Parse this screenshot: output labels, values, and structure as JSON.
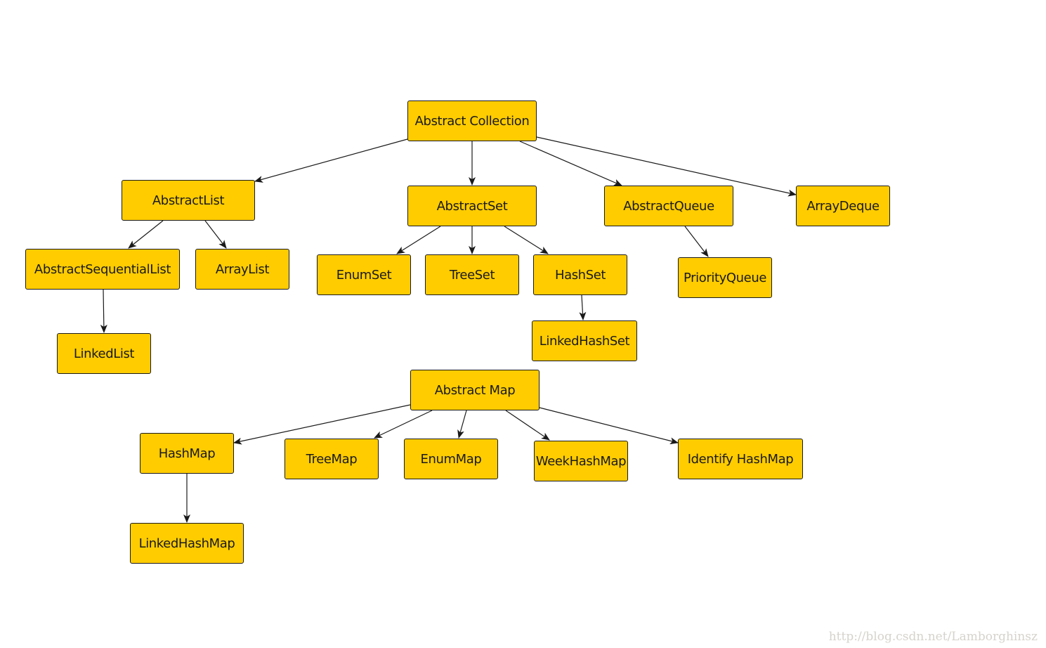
{
  "diagram": {
    "node_color": "#ffcc00",
    "nodes": [
      {
        "id": "abstract-collection",
        "label": "Abstract Collection"
      },
      {
        "id": "abstract-list",
        "label": "AbstractList"
      },
      {
        "id": "abstract-set",
        "label": "AbstractSet"
      },
      {
        "id": "abstract-queue",
        "label": "AbstractQueue"
      },
      {
        "id": "array-deque",
        "label": "ArrayDeque"
      },
      {
        "id": "abstract-sequential-list",
        "label": "AbstractSequentialList"
      },
      {
        "id": "array-list",
        "label": "ArrayList"
      },
      {
        "id": "enum-set",
        "label": "EnumSet"
      },
      {
        "id": "tree-set",
        "label": "TreeSet"
      },
      {
        "id": "hash-set",
        "label": "HashSet"
      },
      {
        "id": "priority-queue",
        "label": "PriorityQueue"
      },
      {
        "id": "linked-list",
        "label": "LinkedList"
      },
      {
        "id": "linked-hash-set",
        "label": "LinkedHashSet"
      },
      {
        "id": "abstract-map",
        "label": "Abstract Map"
      },
      {
        "id": "hash-map",
        "label": "HashMap"
      },
      {
        "id": "tree-map",
        "label": "TreeMap"
      },
      {
        "id": "enum-map",
        "label": "EnumMap"
      },
      {
        "id": "week-hash-map",
        "label": "WeekHashMap"
      },
      {
        "id": "identify-hash-map",
        "label": "Identify HashMap"
      },
      {
        "id": "linked-hash-map",
        "label": "LinkedHashMap"
      }
    ],
    "edges": [
      {
        "from": "abstract-collection",
        "to": "abstract-list"
      },
      {
        "from": "abstract-collection",
        "to": "abstract-set"
      },
      {
        "from": "abstract-collection",
        "to": "abstract-queue"
      },
      {
        "from": "abstract-collection",
        "to": "array-deque"
      },
      {
        "from": "abstract-list",
        "to": "abstract-sequential-list"
      },
      {
        "from": "abstract-list",
        "to": "array-list"
      },
      {
        "from": "abstract-sequential-list",
        "to": "linked-list"
      },
      {
        "from": "abstract-set",
        "to": "enum-set"
      },
      {
        "from": "abstract-set",
        "to": "tree-set"
      },
      {
        "from": "abstract-set",
        "to": "hash-set"
      },
      {
        "from": "hash-set",
        "to": "linked-hash-set"
      },
      {
        "from": "abstract-queue",
        "to": "priority-queue"
      },
      {
        "from": "abstract-map",
        "to": "hash-map"
      },
      {
        "from": "abstract-map",
        "to": "tree-map"
      },
      {
        "from": "abstract-map",
        "to": "enum-map"
      },
      {
        "from": "abstract-map",
        "to": "week-hash-map"
      },
      {
        "from": "abstract-map",
        "to": "identify-hash-map"
      },
      {
        "from": "hash-map",
        "to": "linked-hash-map"
      }
    ]
  },
  "watermark": "http://blog.csdn.net/Lamborghinsz"
}
